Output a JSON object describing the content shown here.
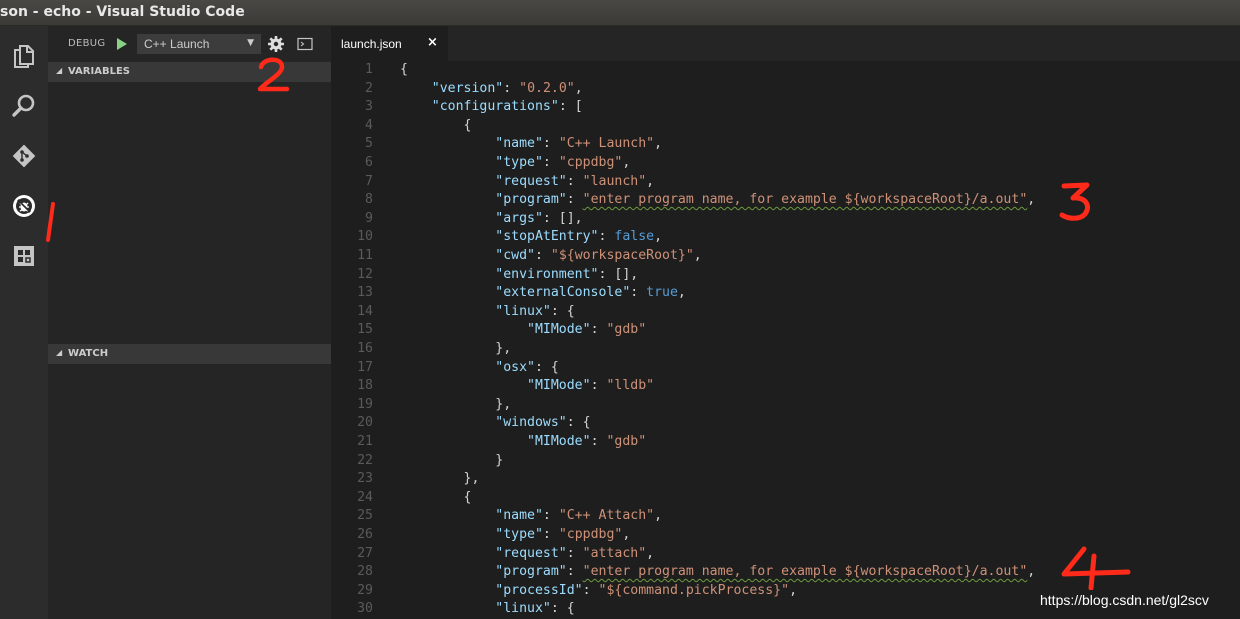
{
  "window": {
    "title": "son - echo - Visual Studio Code"
  },
  "activity_bar": {
    "items": [
      {
        "icon": "files-icon",
        "label": "Explorer"
      },
      {
        "icon": "search-icon",
        "label": "Search"
      },
      {
        "icon": "git-icon",
        "label": "Git"
      },
      {
        "icon": "debug-icon",
        "label": "Debug",
        "active": true
      },
      {
        "icon": "extensions-icon",
        "label": "Extensions"
      }
    ]
  },
  "debug_toolbar": {
    "label": "DEBUG",
    "play_icon": "play-icon",
    "selected_configuration": "C++ Launch",
    "gear_icon": "gear-icon",
    "console_icon": "terminal-icon"
  },
  "sidebar": {
    "variables_label": "VARIABLES",
    "watch_label": "WATCH"
  },
  "editor": {
    "tab_label": "launch.json",
    "close_glyph": "×",
    "line_numbers": [
      "1",
      "2",
      "3",
      "4",
      "5",
      "6",
      "7",
      "8",
      "9",
      "10",
      "11",
      "12",
      "13",
      "14",
      "15",
      "16",
      "17",
      "18",
      "19",
      "20",
      "21",
      "22",
      "23",
      "24",
      "25",
      "26",
      "27",
      "28",
      "29",
      "30"
    ],
    "strings": {
      "version_key": "\"version\"",
      "version_val": "\"0.2.0\"",
      "configurations_key": "\"configurations\"",
      "name_key": "\"name\"",
      "name_launch": "\"C++ Launch\"",
      "name_attach": "\"C++ Attach\"",
      "type_key": "\"type\"",
      "type_val": "\"cppdbg\"",
      "request_key": "\"request\"",
      "request_launch": "\"launch\"",
      "request_attach": "\"attach\"",
      "program_key": "\"program\"",
      "program_val": "\"enter program name, for example ${workspaceRoot}/a.out\"",
      "args_key": "\"args\"",
      "stopAtEntry_key": "\"stopAtEntry\"",
      "false_val": "false",
      "cwd_key": "\"cwd\"",
      "cwd_val": "\"${workspaceRoot}\"",
      "environment_key": "\"environment\"",
      "externalConsole_key": "\"externalConsole\"",
      "true_val": "true",
      "linux_key": "\"linux\"",
      "osx_key": "\"osx\"",
      "windows_key": "\"windows\"",
      "mimode_key": "\"MIMode\"",
      "gdb_val": "\"gdb\"",
      "lldb_val": "\"lldb\"",
      "processId_key": "\"processId\"",
      "processId_val": "\"${command.pickProcess}\""
    }
  },
  "annotations": {
    "colors": {
      "marker": "#ff2a1a"
    }
  },
  "watermark": "https://blog.csdn.net/gl2scv",
  "colors": {
    "background": "#1e1e1e",
    "sidebar": "#252526",
    "activity_bar": "#2c2c2c",
    "key": "#9cdcfe",
    "string": "#ce9178",
    "keyword": "#569cd6",
    "play": "#89d185"
  }
}
